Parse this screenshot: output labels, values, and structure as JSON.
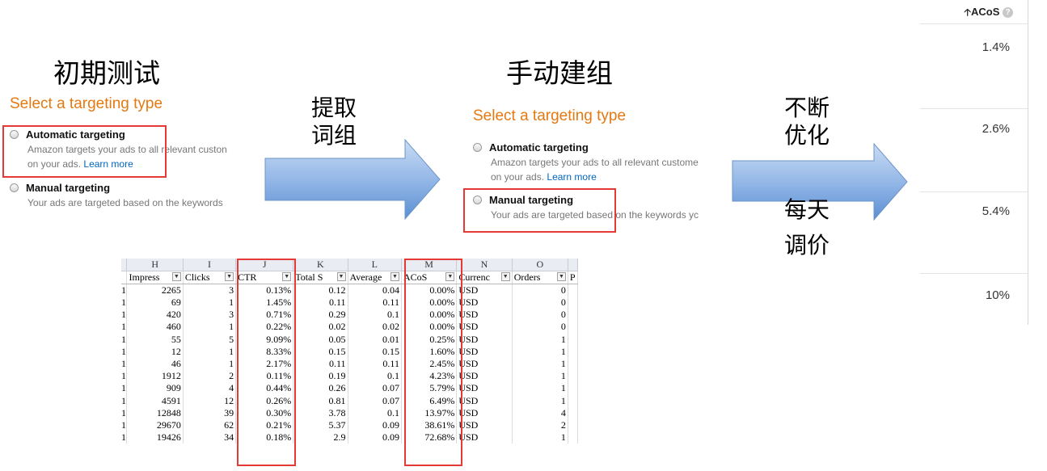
{
  "headings": {
    "initial_test": "初期测试",
    "manual_group": "手动建组"
  },
  "left_panel": {
    "title": "Select a targeting type",
    "automatic": {
      "label": "Automatic targeting",
      "desc_line1": "Amazon targets your ads to all relevant custon",
      "desc_line2": "on your ads.",
      "learn_more": "Learn more"
    },
    "manual": {
      "label": "Manual targeting",
      "desc": "Your ads are targeted based on the keywords"
    }
  },
  "middle_panel": {
    "title": "Select a targeting type",
    "automatic": {
      "label": "Automatic targeting",
      "desc_line1": "Amazon targets your ads to all relevant custome",
      "desc_line2": "on your ads.",
      "learn_more": "Learn more"
    },
    "manual": {
      "label": "Manual targeting",
      "desc": "Your ads are targeted based on the keywords yc"
    }
  },
  "arrows": {
    "arrow1_line1": "提取",
    "arrow1_line2": "词组",
    "arrow2_line1": "不断",
    "arrow2_line2": "优化",
    "below1": "每天",
    "below2": "调价"
  },
  "acos_panel": {
    "header": "ACoS",
    "sort_icon": "up-arrow-icon",
    "help_icon": "question-circle-icon",
    "values": [
      "1.4%",
      "2.6%",
      "5.4%",
      "10%"
    ]
  },
  "spreadsheet": {
    "column_letters": [
      "H",
      "I",
      "J",
      "K",
      "L",
      "M",
      "N",
      "O"
    ],
    "headers": [
      "Impress",
      "Clicks",
      "CTR",
      "Total S",
      "Average",
      "ACoS",
      "Currenc",
      "Orders",
      "P"
    ],
    "rows": [
      [
        "2265",
        "3",
        "0.13%",
        "0.12",
        "0.04",
        "0.00%",
        "USD",
        "0"
      ],
      [
        "69",
        "1",
        "1.45%",
        "0.11",
        "0.11",
        "0.00%",
        "USD",
        "0"
      ],
      [
        "420",
        "3",
        "0.71%",
        "0.29",
        "0.1",
        "0.00%",
        "USD",
        "0"
      ],
      [
        "460",
        "1",
        "0.22%",
        "0.02",
        "0.02",
        "0.00%",
        "USD",
        "0"
      ],
      [
        "55",
        "5",
        "9.09%",
        "0.05",
        "0.01",
        "0.25%",
        "USD",
        "1"
      ],
      [
        "12",
        "1",
        "8.33%",
        "0.15",
        "0.15",
        "1.60%",
        "USD",
        "1"
      ],
      [
        "46",
        "1",
        "2.17%",
        "0.11",
        "0.11",
        "2.45%",
        "USD",
        "1"
      ],
      [
        "1912",
        "2",
        "0.11%",
        "0.19",
        "0.1",
        "4.23%",
        "USD",
        "1"
      ],
      [
        "909",
        "4",
        "0.44%",
        "0.26",
        "0.07",
        "5.79%",
        "USD",
        "1"
      ],
      [
        "4591",
        "12",
        "0.26%",
        "0.81",
        "0.07",
        "6.49%",
        "USD",
        "1"
      ],
      [
        "12848",
        "39",
        "0.30%",
        "3.78",
        "0.1",
        "13.97%",
        "USD",
        "4"
      ],
      [
        "29670",
        "62",
        "0.21%",
        "5.37",
        "0.09",
        "38.61%",
        "USD",
        "2"
      ],
      [
        "19426",
        "34",
        "0.18%",
        "2.9",
        "0.09",
        "72.68%",
        "USD",
        "1"
      ]
    ],
    "left_edge_value": "1"
  },
  "colors": {
    "accent_orange": "#e47911",
    "link_blue": "#0066c0",
    "highlight_red": "#e53935",
    "arrow_fill_light": "#c9dcf4",
    "arrow_fill_dark": "#5b8fd2"
  }
}
